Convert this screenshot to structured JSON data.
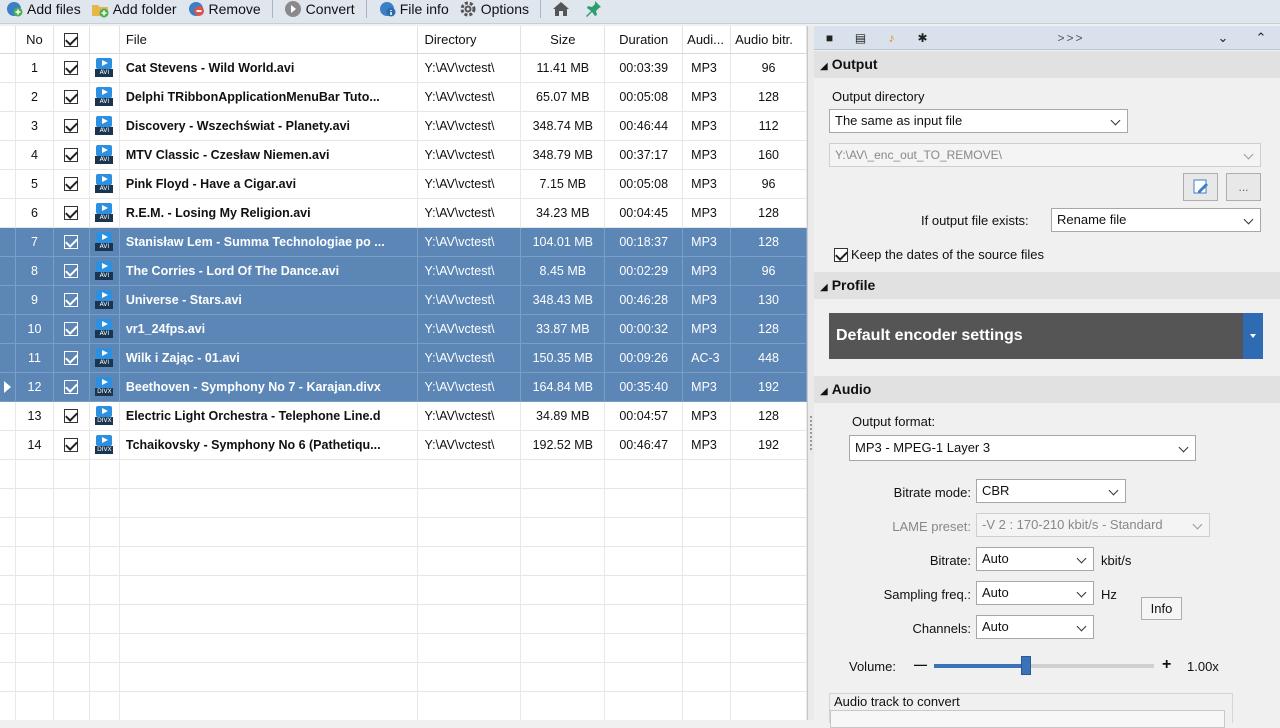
{
  "toolbar": {
    "add_files": "Add files",
    "add_folder": "Add folder",
    "remove": "Remove",
    "convert": "Convert",
    "file_info": "File info",
    "options": "Options"
  },
  "grid": {
    "headers": {
      "no": "No",
      "file": "File",
      "directory": "Directory",
      "size": "Size",
      "duration": "Duration",
      "audio": "Audi...",
      "audio_bitrate": "Audio bitr."
    },
    "rows": [
      {
        "no": "1",
        "file": "Cat Stevens - Wild World.avi",
        "dir": "Y:\\AV\\vctest\\",
        "size": "11.41 MB",
        "duration": "00:03:39",
        "audio": "MP3",
        "bitrate": "96",
        "type": "AVI",
        "selected": false
      },
      {
        "no": "2",
        "file": "Delphi TRibbonApplicationMenuBar Tuto...",
        "dir": "Y:\\AV\\vctest\\",
        "size": "65.07 MB",
        "duration": "00:05:08",
        "audio": "MP3",
        "bitrate": "128",
        "type": "AVI",
        "selected": false
      },
      {
        "no": "3",
        "file": "Discovery - Wszechświat - Planety.avi",
        "dir": "Y:\\AV\\vctest\\",
        "size": "348.74 MB",
        "duration": "00:46:44",
        "audio": "MP3",
        "bitrate": "112",
        "type": "AVI",
        "selected": false
      },
      {
        "no": "4",
        "file": "MTV Classic - Czesław Niemen.avi",
        "dir": "Y:\\AV\\vctest\\",
        "size": "348.79 MB",
        "duration": "00:37:17",
        "audio": "MP3",
        "bitrate": "160",
        "type": "AVI",
        "selected": false
      },
      {
        "no": "5",
        "file": "Pink Floyd - Have a Cigar.avi",
        "dir": "Y:\\AV\\vctest\\",
        "size": "7.15 MB",
        "duration": "00:05:08",
        "audio": "MP3",
        "bitrate": "96",
        "type": "AVI",
        "selected": false
      },
      {
        "no": "6",
        "file": "R.E.M. - Losing My Religion.avi",
        "dir": "Y:\\AV\\vctest\\",
        "size": "34.23 MB",
        "duration": "00:04:45",
        "audio": "MP3",
        "bitrate": "128",
        "type": "AVI",
        "selected": false
      },
      {
        "no": "7",
        "file": "Stanisław Lem - Summa Technologiae po ...",
        "dir": "Y:\\AV\\vctest\\",
        "size": "104.01 MB",
        "duration": "00:18:37",
        "audio": "MP3",
        "bitrate": "128",
        "type": "AVI",
        "selected": true
      },
      {
        "no": "8",
        "file": "The Corries - Lord Of The Dance.avi",
        "dir": "Y:\\AV\\vctest\\",
        "size": "8.45 MB",
        "duration": "00:02:29",
        "audio": "MP3",
        "bitrate": "96",
        "type": "AVI",
        "selected": true
      },
      {
        "no": "9",
        "file": "Universe - Stars.avi",
        "dir": "Y:\\AV\\vctest\\",
        "size": "348.43 MB",
        "duration": "00:46:28",
        "audio": "MP3",
        "bitrate": "130",
        "type": "AVI",
        "selected": true
      },
      {
        "no": "10",
        "file": "vr1_24fps.avi",
        "dir": "Y:\\AV\\vctest\\",
        "size": "33.87 MB",
        "duration": "00:00:32",
        "audio": "MP3",
        "bitrate": "128",
        "type": "AVI",
        "selected": true
      },
      {
        "no": "11",
        "file": "Wilk i Zając - 01.avi",
        "dir": "Y:\\AV\\vctest\\",
        "size": "150.35 MB",
        "duration": "00:09:26",
        "audio": "AC-3",
        "bitrate": "448",
        "type": "AVI",
        "selected": true
      },
      {
        "no": "12",
        "file": "Beethoven - Symphony No 7 - Karajan.divx",
        "dir": "Y:\\AV\\vctest\\",
        "size": "164.84 MB",
        "duration": "00:35:40",
        "audio": "MP3",
        "bitrate": "192",
        "type": "DIVX",
        "selected": true,
        "current": true
      },
      {
        "no": "13",
        "file": "Electric Light Orchestra - Telephone Line.d",
        "dir": "Y:\\AV\\vctest\\",
        "size": "34.89 MB",
        "duration": "00:04:57",
        "audio": "MP3",
        "bitrate": "128",
        "type": "DIVX",
        "selected": false
      },
      {
        "no": "14",
        "file": "Tchaikovsky - Symphony No 6 (Pathetiqu...",
        "dir": "Y:\\AV\\vctest\\",
        "size": "192.52 MB",
        "duration": "00:46:47",
        "audio": "MP3",
        "bitrate": "192",
        "type": "DIVX",
        "selected": false
      }
    ]
  },
  "panel": {
    "tabs_more": ">>>",
    "output": {
      "title": "Output",
      "dir_label": "Output directory",
      "dir_mode": "The same as input file",
      "dir_path": "Y:\\AV\\_enc_out_TO_REMOVE\\",
      "browse_label": "...",
      "exists_label": "If output file exists:",
      "exists_value": "Rename file",
      "keep_dates": "Keep the dates of the source files"
    },
    "profile": {
      "title": "Profile",
      "value": "Default encoder settings"
    },
    "audio": {
      "title": "Audio",
      "format_label": "Output format:",
      "format_value": "MP3 - MPEG-1 Layer 3",
      "bitrate_mode_label": "Bitrate mode:",
      "bitrate_mode_value": "CBR",
      "lame_label": "LAME preset:",
      "lame_value": "-V 2 : 170-210 kbit/s - Standard",
      "bitrate_label": "Bitrate:",
      "bitrate_value": "Auto",
      "bitrate_unit": "kbit/s",
      "sampling_label": "Sampling freq.:",
      "sampling_value": "Auto",
      "sampling_unit": "Hz",
      "channels_label": "Channels:",
      "channels_value": "Auto",
      "info_button": "Info",
      "volume_label": "Volume:",
      "volume_minus": "—",
      "volume_plus": "+",
      "volume_value": "1.00x",
      "volume_fraction": 0.42,
      "track_label": "Audio track to convert"
    }
  }
}
